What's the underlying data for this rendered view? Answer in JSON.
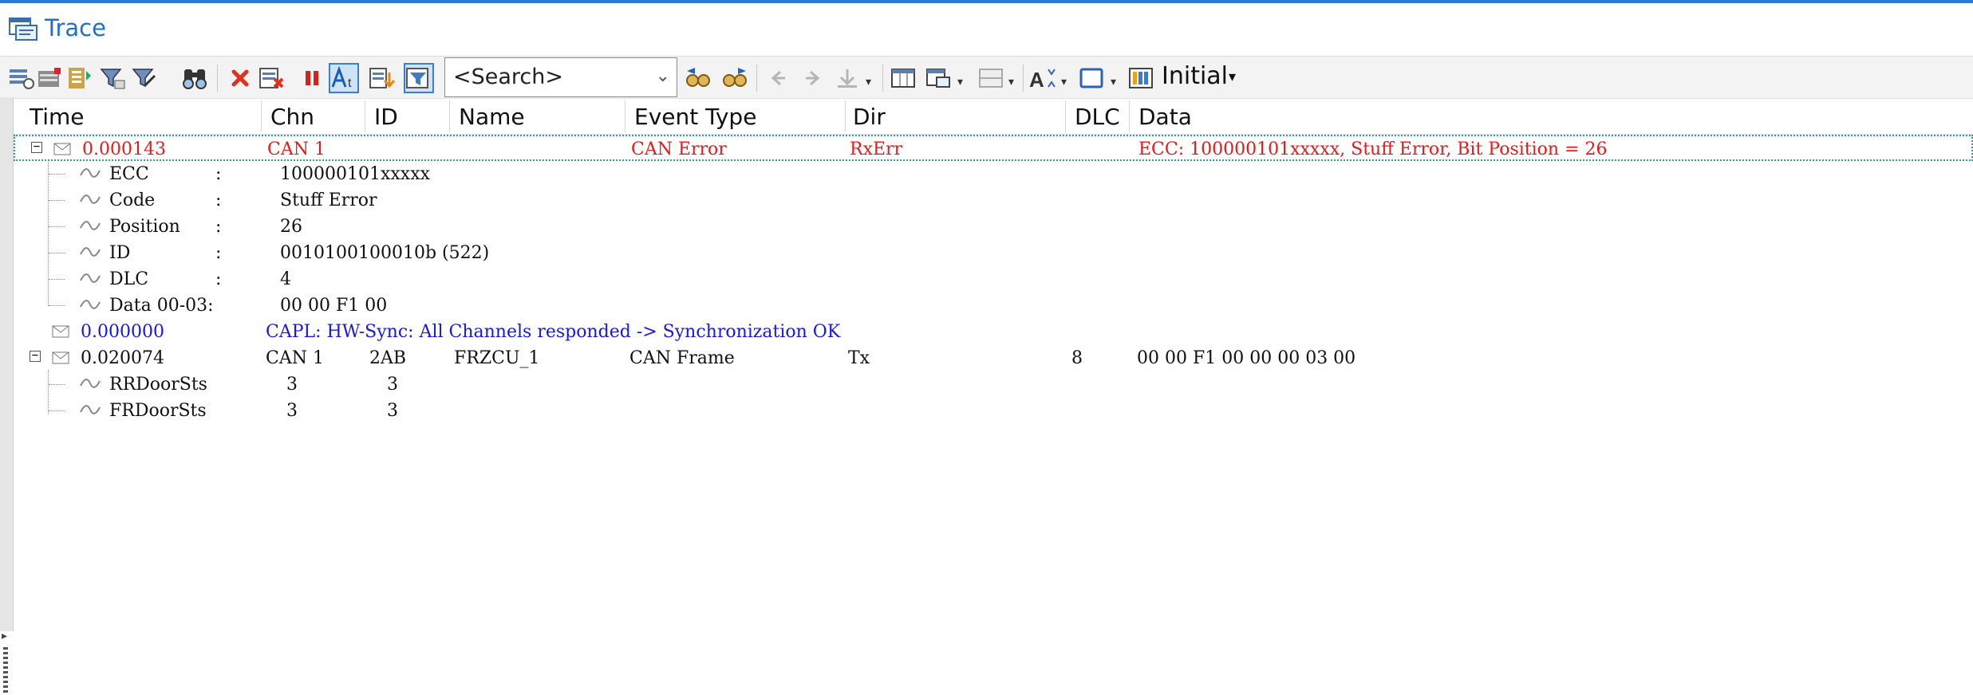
{
  "window": {
    "title": "Trace"
  },
  "toolbar": {
    "search_placeholder": "<Search>",
    "view_label": "Initial"
  },
  "columns": [
    "Time",
    "Chn",
    "ID",
    "Name",
    "Event Type",
    "Dir",
    "DLC",
    "Data"
  ],
  "rows": {
    "error": {
      "time": "0.000143",
      "chn": "CAN 1",
      "event_type": "CAN Error",
      "dir": "RxErr",
      "data": "ECC: 100000101xxxxx, Stuff Error, Bit Position = 26",
      "children": [
        {
          "name": "ECC",
          "sep": ":",
          "value": "100000101xxxxx"
        },
        {
          "name": "Code",
          "sep": ":",
          "value": "Stuff Error"
        },
        {
          "name": "Position",
          "sep": ":",
          "value": "26"
        },
        {
          "name": "ID",
          "sep": ":",
          "value": "0010100100010b (522)"
        },
        {
          "name": "DLC",
          "sep": ":",
          "value": "4"
        },
        {
          "name": "Data 00-03:",
          "sep": "",
          "value": "00 00 F1 00"
        }
      ]
    },
    "capl": {
      "time": "0.000000",
      "text": "CAPL: HW-Sync: All Channels responded -> Synchronization OK"
    },
    "frame": {
      "time": "0.020074",
      "chn": "CAN 1",
      "id": "2AB",
      "name": "FRZCU_1",
      "event_type": "CAN Frame",
      "dir": "Tx",
      "dlc": "8",
      "data": "00 00 F1 00 00 00 03 00",
      "signals": [
        {
          "name": "RRDoorSts",
          "raw": "3",
          "phys": "3"
        },
        {
          "name": "FRDoorSts",
          "raw": "3",
          "phys": "3"
        }
      ]
    }
  },
  "colors": {
    "error": "#e41b1b",
    "capl": "#1818e0",
    "accent": "#1e6fd0"
  }
}
